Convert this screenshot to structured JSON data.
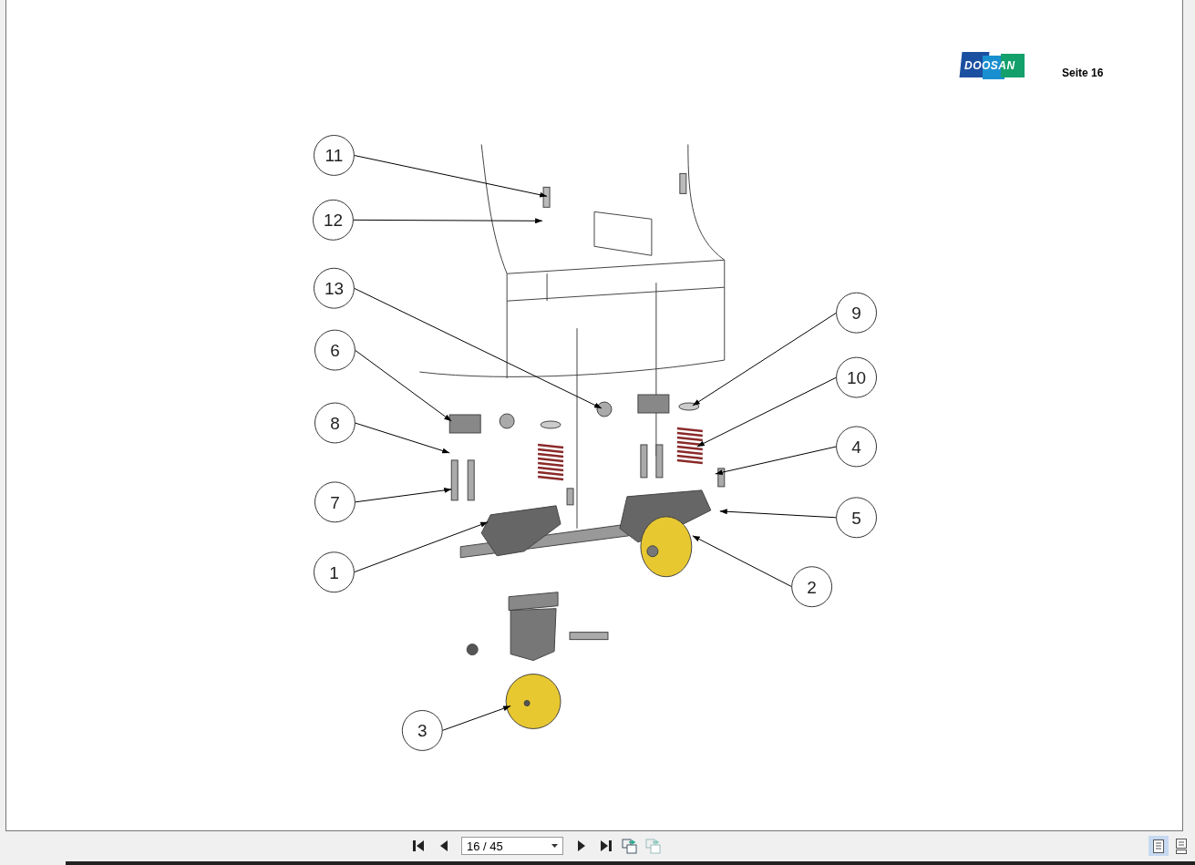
{
  "page": {
    "logo": "DOOSAN",
    "page_label": "Seite 16",
    "callouts": [
      {
        "number": "11"
      },
      {
        "number": "12"
      },
      {
        "number": "13"
      },
      {
        "number": "6"
      },
      {
        "number": "8"
      },
      {
        "number": "7"
      },
      {
        "number": "1"
      },
      {
        "number": "3"
      },
      {
        "number": "9"
      },
      {
        "number": "10"
      },
      {
        "number": "4"
      },
      {
        "number": "5"
      },
      {
        "number": "2"
      }
    ]
  },
  "toolbar": {
    "page_field": {
      "value": "16 / 45"
    },
    "buttons": [
      {
        "kind": "first",
        "disabled": false
      },
      {
        "kind": "prev",
        "disabled": false
      },
      {
        "kind": "next",
        "disabled": false
      },
      {
        "kind": "last",
        "disabled": false
      },
      {
        "kind": "back",
        "disabled": false
      },
      {
        "kind": "forward",
        "disabled": true
      }
    ],
    "view_modes": [
      {
        "kind": "single",
        "selected": true
      },
      {
        "kind": "continuous",
        "selected": false
      }
    ]
  }
}
